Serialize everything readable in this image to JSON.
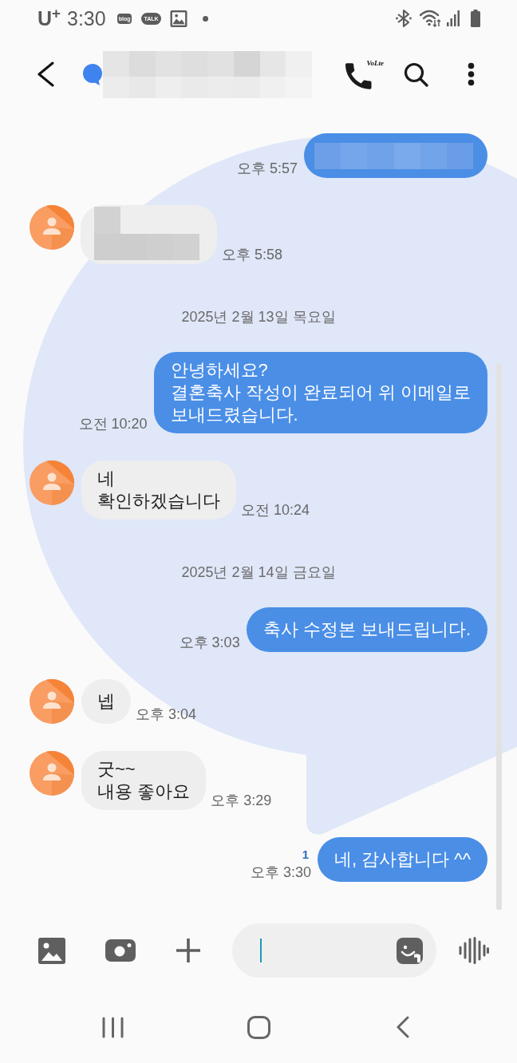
{
  "status_bar": {
    "carrier": "U$^{+}$",
    "time": "3:30",
    "blog_badge": "blog",
    "talk_badge": "TALK"
  },
  "header": {
    "call_badge": "VoLte"
  },
  "messages": [
    {
      "kind": "sent",
      "redacted": true,
      "time": "오후 5:57"
    },
    {
      "kind": "received",
      "redacted": true,
      "time": "오후 5:58"
    },
    {
      "kind": "date",
      "text": "2025년 2월 13일 목요일"
    },
    {
      "kind": "sent",
      "redacted": false,
      "text": "안녕하세요?\n결혼축사 작성이 완료되어 위 이메일로\n보내드렸습니다.",
      "time": "오전 10:20"
    },
    {
      "kind": "received",
      "redacted": false,
      "text": "네\n확인하겠습니다",
      "time": "오전 10:24"
    },
    {
      "kind": "date",
      "text": "2025년 2월 14일 금요일"
    },
    {
      "kind": "sent",
      "redacted": false,
      "text": "축사 수정본 보내드립니다.",
      "time": "오후 3:03"
    },
    {
      "kind": "received",
      "redacted": false,
      "text": "넵",
      "time": "오후 3:04"
    },
    {
      "kind": "received",
      "redacted": false,
      "text": "굿~~\n내용 좋아요",
      "time": "오후 3:29"
    },
    {
      "kind": "sent",
      "redacted": false,
      "text": "네, 감사합니다 ^^",
      "time": "오후 3:30",
      "unread": "1"
    }
  ],
  "composer": {
    "focused": true
  }
}
